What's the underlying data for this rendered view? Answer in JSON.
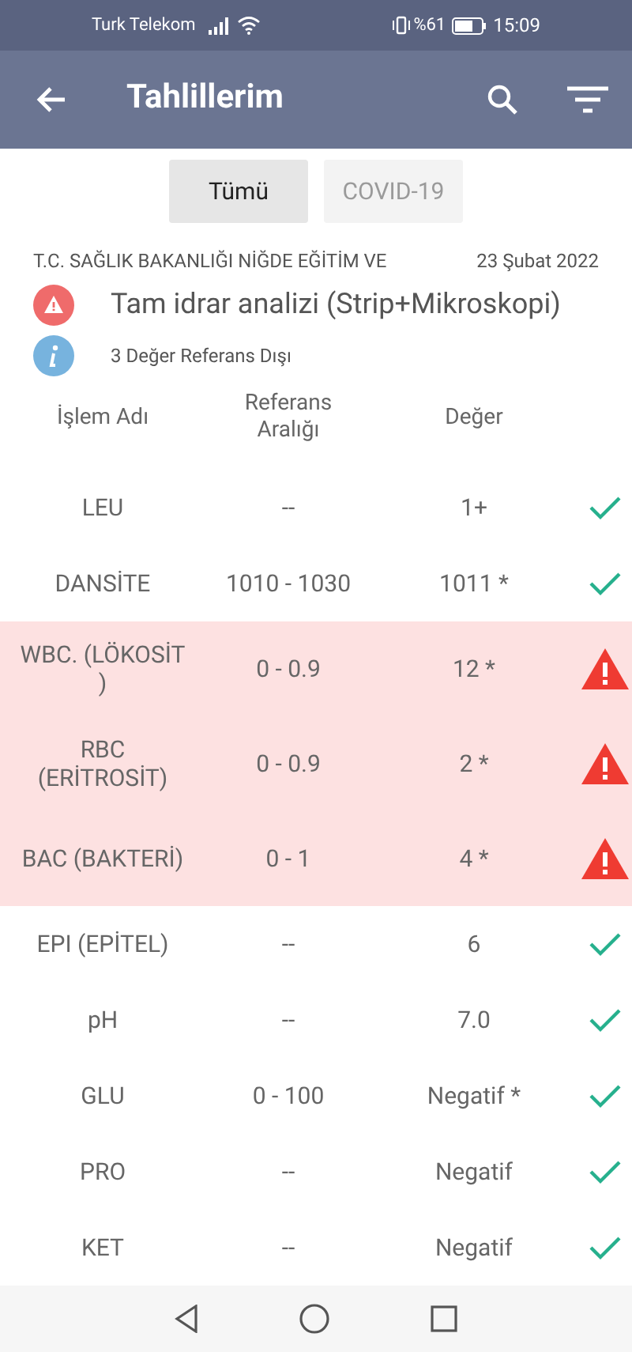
{
  "status_bar": {
    "carrier": "Turk Telekom",
    "battery": "%61",
    "time": "15:09"
  },
  "app_bar": {
    "title": "Tahlillerim"
  },
  "tabs": [
    {
      "label": "Tümü",
      "selected": true
    },
    {
      "label": "COVID-19",
      "selected": false
    }
  ],
  "report": {
    "institution": "T.C. SAĞLIK BAKANLIĞI NİĞDE EĞİTİM VE",
    "date": "23 Şubat 2022",
    "test_name": "Tam idrar analizi (Strip+Mikroskopi)",
    "note": "3 Değer Referans Dışı"
  },
  "table": {
    "columns": [
      "İşlem Adı",
      "Referans Aralığı",
      "Değer"
    ],
    "rows": [
      {
        "name": "LEU",
        "reference": "--",
        "value": "1+",
        "abnormal": false
      },
      {
        "name": "DANSİTE",
        "reference": "1010 - 1030",
        "value": "1011 *",
        "abnormal": false
      },
      {
        "name": "WBC. (LÖKOSİT )",
        "reference": "0 - 0.9",
        "value": "12 *",
        "abnormal": true
      },
      {
        "name": "RBC (ERİTROSİT)",
        "reference": "0 - 0.9",
        "value": "2 *",
        "abnormal": true
      },
      {
        "name": "BAC (BAKTERİ)",
        "reference": "0 - 1",
        "value": "4 *",
        "abnormal": true
      },
      {
        "name": "EPI (EPİTEL)",
        "reference": "--",
        "value": "6",
        "abnormal": false
      },
      {
        "name": "pH",
        "reference": "--",
        "value": "7.0",
        "abnormal": false
      },
      {
        "name": "GLU",
        "reference": "0 - 100",
        "value": "Negatif *",
        "abnormal": false
      },
      {
        "name": "PRO",
        "reference": "--",
        "value": "Negatif",
        "abnormal": false
      },
      {
        "name": "KET",
        "reference": "--",
        "value": "Negatif",
        "abnormal": false
      }
    ]
  }
}
